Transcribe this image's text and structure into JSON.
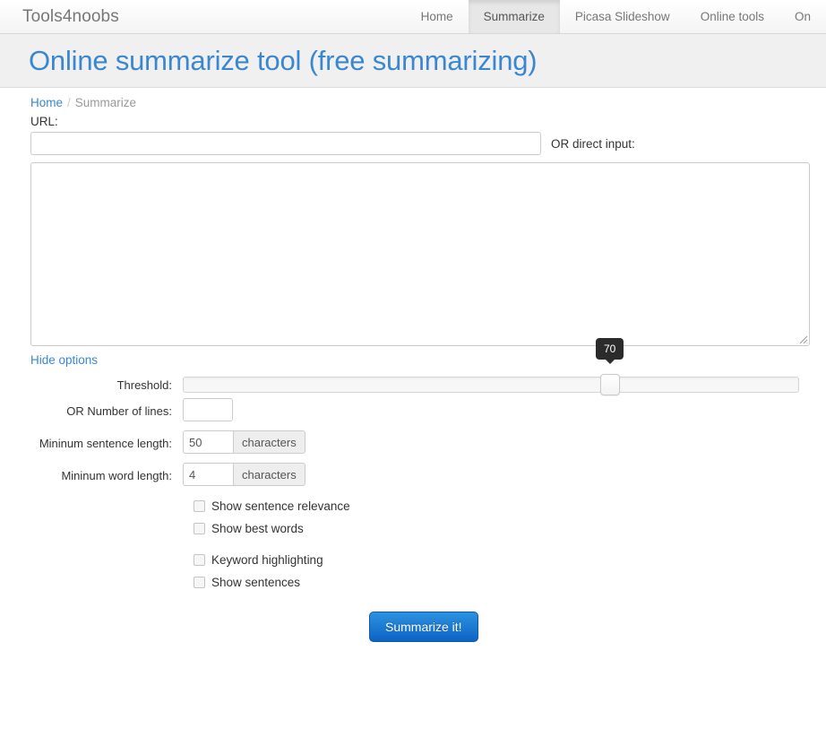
{
  "navbar": {
    "brand": "Tools4noobs",
    "items": [
      {
        "label": "Home",
        "active": false
      },
      {
        "label": "Summarize",
        "active": true
      },
      {
        "label": "Picasa Slideshow",
        "active": false
      },
      {
        "label": "Online tools",
        "active": false
      },
      {
        "label": "On",
        "active": false
      }
    ]
  },
  "header": {
    "title": "Online summarize tool (free summarizing)"
  },
  "breadcrumb": {
    "home": "Home",
    "separator": "/",
    "current": "Summarize"
  },
  "form": {
    "url_label": "URL:",
    "url_value": "",
    "url_placeholder": "",
    "or_direct_label": "OR direct input:",
    "textarea_value": "",
    "textarea_placeholder": "",
    "hide_options_label": "Hide options",
    "threshold_label": "Threshold:",
    "threshold_value": "70",
    "number_of_lines_label": "OR Number of lines:",
    "number_of_lines_value": "",
    "min_sentence_label": "Mininum sentence length:",
    "min_sentence_value": "50",
    "min_sentence_addon": "characters",
    "min_word_label": "Mininum word length:",
    "min_word_value": "4",
    "min_word_addon": "characters",
    "checkboxes": [
      {
        "label": "Show sentence relevance",
        "checked": false
      },
      {
        "label": "Show best words",
        "checked": false
      },
      {
        "label": "Keyword highlighting",
        "checked": false
      },
      {
        "label": "Show sentences",
        "checked": false
      }
    ],
    "submit_label": "Summarize it!"
  },
  "colors": {
    "accent_blue": "#3a87d0",
    "button_blue_top": "#2d92e0",
    "button_blue_bottom": "#0c63c4",
    "title_band": "#f0f0f0",
    "nav_active": "#e7e7e7",
    "tooltip_bg": "#2b2b2b"
  }
}
